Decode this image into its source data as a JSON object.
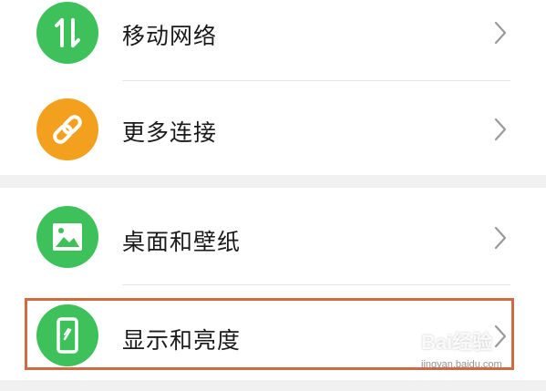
{
  "settings": {
    "groups": [
      {
        "items": [
          {
            "label": "移动网络",
            "icon": "mobile-data-icon",
            "color": "#3ec15a"
          },
          {
            "label": "更多连接",
            "icon": "link-icon",
            "color": "#f3a01f"
          }
        ]
      },
      {
        "items": [
          {
            "label": "桌面和壁纸",
            "icon": "image-icon",
            "color": "#3ec15a"
          },
          {
            "label": "显示和亮度",
            "icon": "phone-display-icon",
            "color": "#3ec15a"
          }
        ]
      }
    ]
  },
  "highlight_color": "#d06a43",
  "watermark": {
    "main": "Bai经验",
    "sub": "jingyan.baidu.com"
  }
}
